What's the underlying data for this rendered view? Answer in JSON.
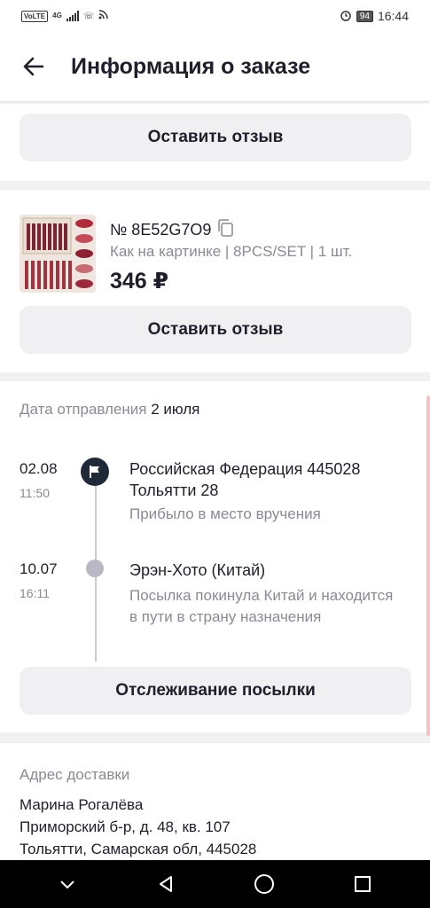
{
  "status_bar": {
    "volte": "VoLTE",
    "network": "4G",
    "battery": "94",
    "time": "16:44"
  },
  "header": {
    "title": "Информация о заказе",
    "back_icon": "arrow-left-icon"
  },
  "review_top": {
    "label": "Оставить отзыв"
  },
  "product": {
    "order_number": "№ 8E52G7O9",
    "variant": "Как на картинке | 8PCS/SET | 1 шт.",
    "price": "346 ₽",
    "review_label": "Оставить отзыв"
  },
  "tracking": {
    "ship_date_label": "Дата отправления",
    "ship_date_value": "2 июля",
    "events": [
      {
        "date": "02.08",
        "time": "11:50",
        "title": "Российская Федерация 445028 Тольятти 28",
        "description": "Прибыло в место вручения"
      },
      {
        "date": "10.07",
        "time": "16:11",
        "title": "Эрэн-Хото (Китай)",
        "description": "Посылка покинула Китай и находится в пути в страну назначения"
      }
    ],
    "track_button": "Отслеживание посылки"
  },
  "address": {
    "title": "Адрес доставки",
    "name": "Марина Рогалёва",
    "street": "Приморский б-р, д. 48, кв. 107",
    "city": "Тольятти, Самарская обл, 445028"
  },
  "colors": {
    "accent_dark": "#1f2937",
    "button_bg": "#f0f0f3",
    "muted_text": "#8a8a95",
    "scroll_indicator": "#f3c2c2"
  }
}
